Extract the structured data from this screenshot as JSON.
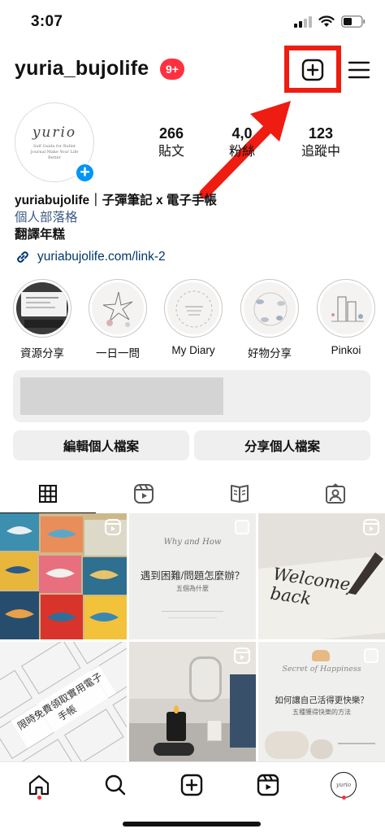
{
  "status_bar": {
    "time": "3:07"
  },
  "header": {
    "username": "yuria_bujolife",
    "notifications_badge": "9+"
  },
  "avatar": {
    "brand": "yurio",
    "tagline": "Self Guide for Bullet Journal Make Your Life Better"
  },
  "stats": [
    {
      "value": "266",
      "label": "貼文"
    },
    {
      "value": "4,0",
      "label": "粉絲"
    },
    {
      "value": "123",
      "label": "追蹤中"
    }
  ],
  "bio": {
    "name": "yuriabujolife｜子彈筆記 x 電子手帳",
    "category": "個人部落格",
    "line": "翻譯年糕",
    "link": "yuriabujolife.com/link-2"
  },
  "highlights": [
    {
      "label": "資源分享"
    },
    {
      "label": "一日一問"
    },
    {
      "label": "My Diary"
    },
    {
      "label": "好物分享"
    },
    {
      "label": "Pinkoi"
    }
  ],
  "buttons": {
    "edit_profile": "編輯個人檔案",
    "share_profile": "分享個人檔案"
  },
  "posts": [
    {
      "kind": "reel",
      "description": "colorful whale paintings"
    },
    {
      "kind": "post",
      "title_script": "Why and How",
      "title": "遇到困難/問題怎麼辦？",
      "subtitle": "五個為什麼"
    },
    {
      "kind": "reel",
      "description": "welcome back calligraphy",
      "script": "Welcome back"
    },
    {
      "kind": "post",
      "title": "限時免費領取實用電子手帳"
    },
    {
      "kind": "reel",
      "description": "candle on desk"
    },
    {
      "kind": "post",
      "title_script": "Secret of Happiness",
      "title": "如何讓自己活得更快樂？",
      "subtitle": "五種獲得快樂的方法"
    }
  ],
  "colors": {
    "badge_red": "#ff3040",
    "link_blue": "#00376b",
    "category_blue": "#3d5a84",
    "highlight_red": "#ee1c11",
    "add_blue": "#0095f6"
  }
}
